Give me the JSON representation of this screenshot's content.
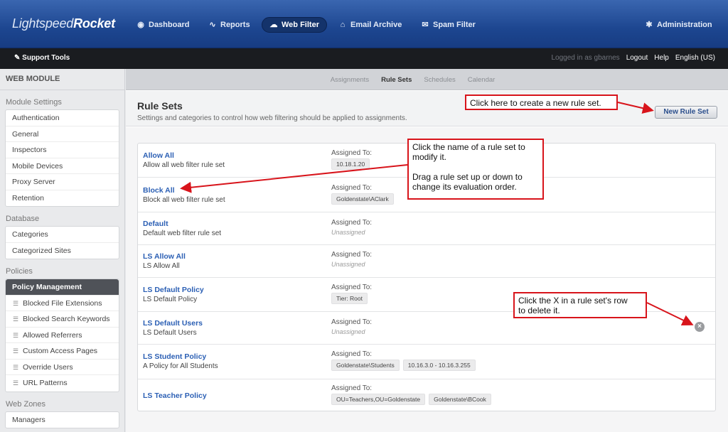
{
  "brand": {
    "part1": "Lightspeed",
    "part2": "Rocket"
  },
  "topnav": [
    {
      "label": "Dashboard",
      "icon": "dashboard-icon",
      "glyph": "◉"
    },
    {
      "label": "Reports",
      "icon": "reports-icon",
      "glyph": "∿"
    },
    {
      "label": "Web Filter",
      "icon": "cloud-icon",
      "glyph": "☁"
    },
    {
      "label": "Email Archive",
      "icon": "inbox-icon",
      "glyph": "⌂"
    },
    {
      "label": "Spam Filter",
      "icon": "envelope-icon",
      "glyph": "✉"
    },
    {
      "label": "Administration",
      "icon": "gear-icon",
      "glyph": "✱"
    }
  ],
  "subbar": {
    "support_tools": "Support Tools",
    "logged_in": "Logged in as gbarnes",
    "logout": "Logout",
    "help": "Help",
    "language": "English (US)"
  },
  "sidebar": {
    "title": "WEB MODULE",
    "sections": {
      "module_settings": "Module Settings",
      "database": "Database",
      "policies": "Policies",
      "web_zones": "Web Zones"
    },
    "module_items": [
      "Authentication",
      "General",
      "Inspectors",
      "Mobile Devices",
      "Proxy Server",
      "Retention"
    ],
    "database_items": [
      "Categories",
      "Categorized Sites"
    ],
    "policy_management": "Policy Management",
    "policy_items": [
      "Blocked File Extensions",
      "Blocked Search Keywords",
      "Allowed Referrers",
      "Custom Access Pages",
      "Override Users",
      "URL Patterns"
    ],
    "zone_items": [
      "Managers"
    ]
  },
  "tabs": [
    "Assignments",
    "Rule Sets",
    "Schedules",
    "Calendar"
  ],
  "active_tab": "Rule Sets",
  "page": {
    "title": "Rule Sets",
    "description": "Settings and categories to control how web filtering should be applied to assignments.",
    "new_button": "New Rule Set",
    "assigned_label": "Assigned To:",
    "unassigned": "Unassigned"
  },
  "rule_sets": [
    {
      "name": "Allow All",
      "desc": "Allow all web filter rule set",
      "assigned": [
        "10.18.1.20"
      ]
    },
    {
      "name": "Block All",
      "desc": "Block all web filter rule set",
      "assigned": [
        "Goldenstate\\AClark"
      ]
    },
    {
      "name": "Default",
      "desc": "Default web filter rule set",
      "assigned": []
    },
    {
      "name": "LS Allow All",
      "desc": "LS Allow All",
      "assigned": []
    },
    {
      "name": "LS Default Policy",
      "desc": "LS Default Policy",
      "assigned": [
        "Tier: Root"
      ]
    },
    {
      "name": "LS Default Users",
      "desc": "LS Default Users",
      "assigned": []
    },
    {
      "name": "LS Student Policy",
      "desc": "A Policy for All Students",
      "assigned": [
        "Goldenstate\\Students",
        "10.16.3.0 - 10.16.3.255"
      ]
    },
    {
      "name": "LS Teacher Policy",
      "desc": "",
      "assigned": [
        "OU=Teachers,OU=Goldenstate",
        "Goldenstate\\BCook"
      ]
    }
  ],
  "callouts": {
    "new": "Click here to create a new rule set.",
    "name_line1": "Click the name of a rule set to",
    "name_line2": "modify it.",
    "drag_line1": "Drag a rule set up or down to",
    "drag_line2": "change its evaluation order.",
    "delete_line1": "Click the X in a rule set's row",
    "delete_line2": "to delete it."
  },
  "colors": {
    "callout_border": "#d8141b",
    "link": "#2b5fb4",
    "header": "#1d4690"
  }
}
